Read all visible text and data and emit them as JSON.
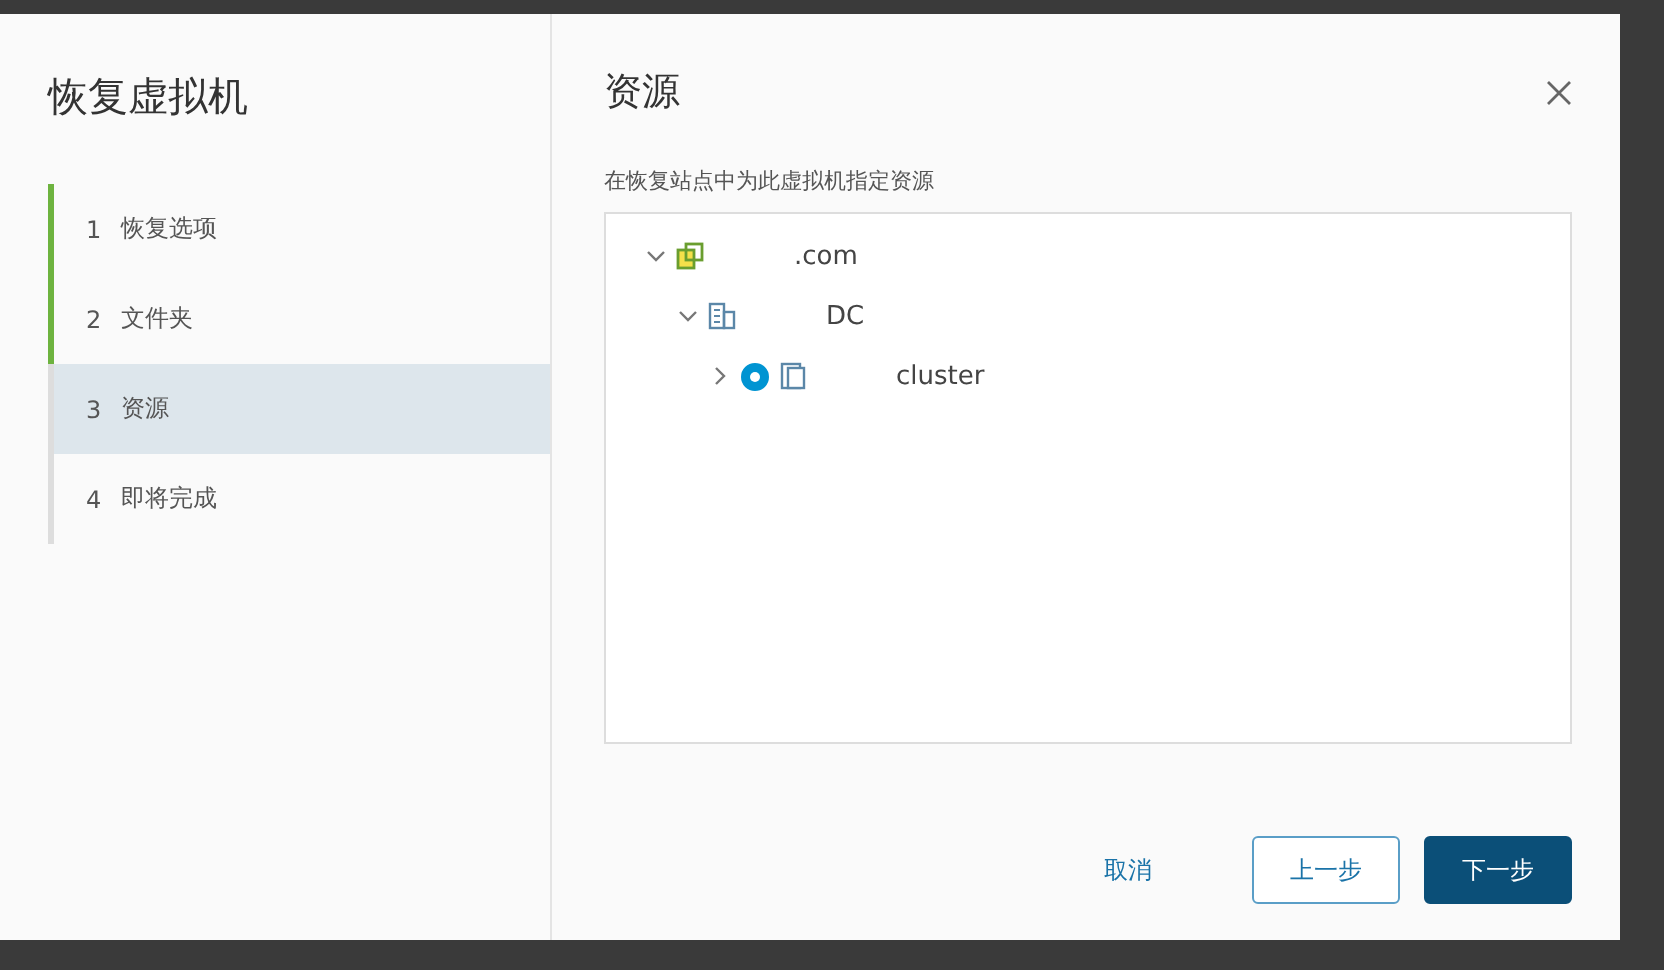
{
  "dialog": {
    "title": "恢复虚拟机",
    "heading": "资源",
    "instruction": "在恢复站点中为此虚拟机指定资源"
  },
  "steps": [
    {
      "number": "1",
      "label": "恢复选项",
      "selected": false,
      "done": true
    },
    {
      "number": "2",
      "label": "文件夹",
      "selected": false,
      "done": true
    },
    {
      "number": "3",
      "label": "资源",
      "selected": true,
      "done": false
    },
    {
      "number": "4",
      "label": "即将完成",
      "selected": false,
      "done": false
    }
  ],
  "tree": [
    {
      "label": ".com",
      "kind": "vcenter",
      "expanded": true,
      "children": [
        {
          "label": "DC",
          "kind": "datacenter",
          "expanded": true,
          "children": [
            {
              "label": "cluster",
              "kind": "cluster",
              "expanded": false,
              "selected": true
            }
          ]
        }
      ]
    }
  ],
  "buttons": [
    {
      "label": "取消",
      "kind": "link"
    },
    {
      "label": "上一步",
      "kind": "outline"
    },
    {
      "label": "下一步",
      "kind": "primary"
    }
  ]
}
